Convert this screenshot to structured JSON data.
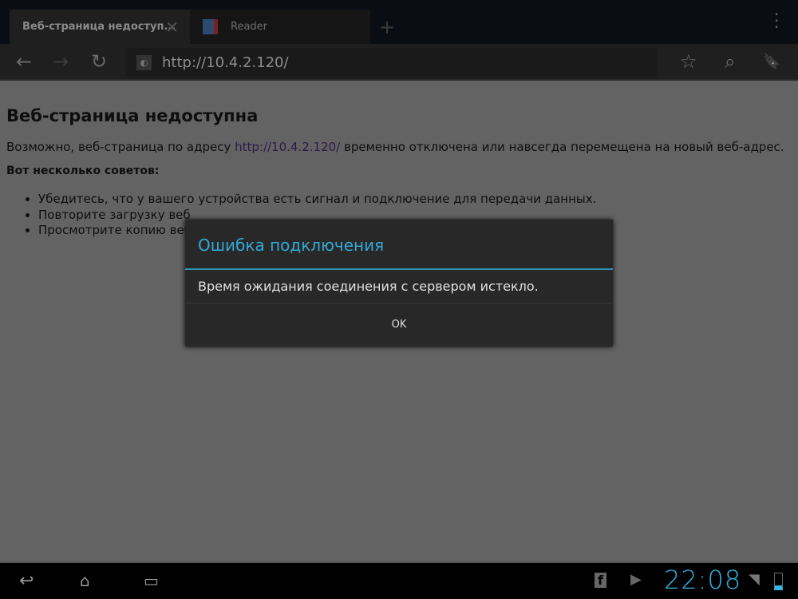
{
  "tabs": [
    {
      "label": "Веб-страница недоступ...",
      "close": "✕"
    },
    {
      "label": "Reader"
    }
  ],
  "new_tab": "+",
  "toolbar": {
    "back": "←",
    "forward": "→",
    "reload": "↻",
    "url": "http://10.4.2.120/",
    "star": "☆",
    "search": "⌕",
    "bookmarks": "🔖"
  },
  "page": {
    "title": "Веб-страница недоступна",
    "msg_before": "Возможно, веб-страница по адресу ",
    "link": "http://10.4.2.120/",
    "msg_after": " временно отключена или навсегда перемещена на новый веб-адрес.",
    "tips_heading": "Вот несколько советов:",
    "tips": [
      "Убедитесь, что у вашего устройства есть сигнал и подключение для передачи данных.",
      "Повторите загрузку веб",
      "Просмотрите копию веб"
    ]
  },
  "dialog": {
    "title": "Ошибка подключения",
    "message": "Время ожидания соединения с сервером истекло.",
    "ok": "OK"
  },
  "status": {
    "time": "22:08",
    "accent": "#33b5e5"
  }
}
